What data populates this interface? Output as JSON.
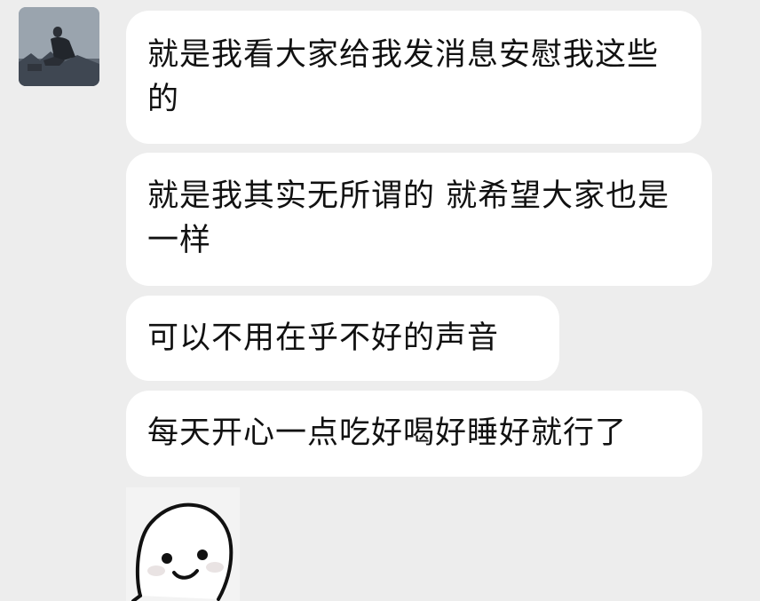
{
  "messages": [
    {
      "text": "就是我看大家给我发消息安慰我这些的"
    },
    {
      "text": "就是我其实无所谓的 就希望大家也是一样"
    },
    {
      "text": "可以不用在乎不好的声音"
    },
    {
      "text": "每天开心一点吃好喝好睡好就行了"
    }
  ],
  "sticker": {
    "icon": "smiling-face-sticker-icon"
  },
  "avatar": {
    "icon": "user-avatar-icon"
  },
  "colors": {
    "background": "#ededed",
    "bubble": "#ffffff",
    "text": "#111111"
  }
}
